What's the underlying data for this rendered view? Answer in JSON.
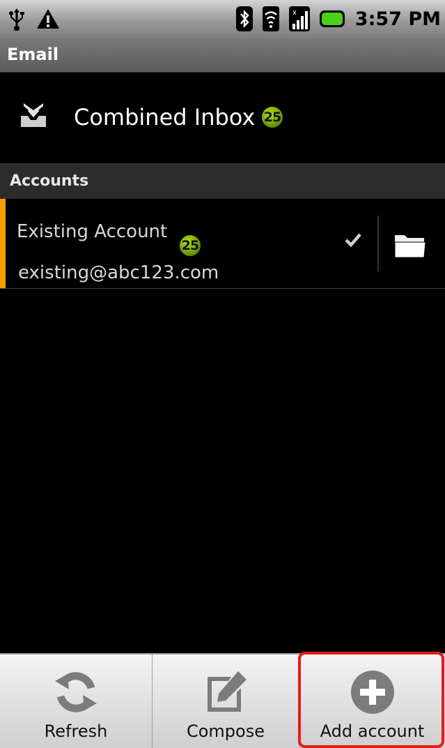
{
  "status_bar": {
    "time": "3:57 PM",
    "left_icons": [
      "usb-icon",
      "warning-icon"
    ],
    "right_icons": [
      "bluetooth-icon",
      "wifi-icon",
      "signal-icon",
      "battery-icon"
    ]
  },
  "app": {
    "title": "Email"
  },
  "combined_inbox": {
    "label": "Combined Inbox",
    "count": "25",
    "icon": "inbox-icon"
  },
  "accounts": {
    "header": "Accounts",
    "items": [
      {
        "name": "Existing Account",
        "email": "existing@abc123.com",
        "count": "25",
        "accent_color": "#f5a000"
      }
    ]
  },
  "menu": {
    "items": [
      {
        "label": "Refresh",
        "icon": "refresh-icon"
      },
      {
        "label": "Compose",
        "icon": "compose-icon"
      },
      {
        "label": "Add account",
        "icon": "add-icon"
      }
    ]
  },
  "colors": {
    "badge_green": "#7fb010",
    "highlight_red": "#e31b1b"
  }
}
